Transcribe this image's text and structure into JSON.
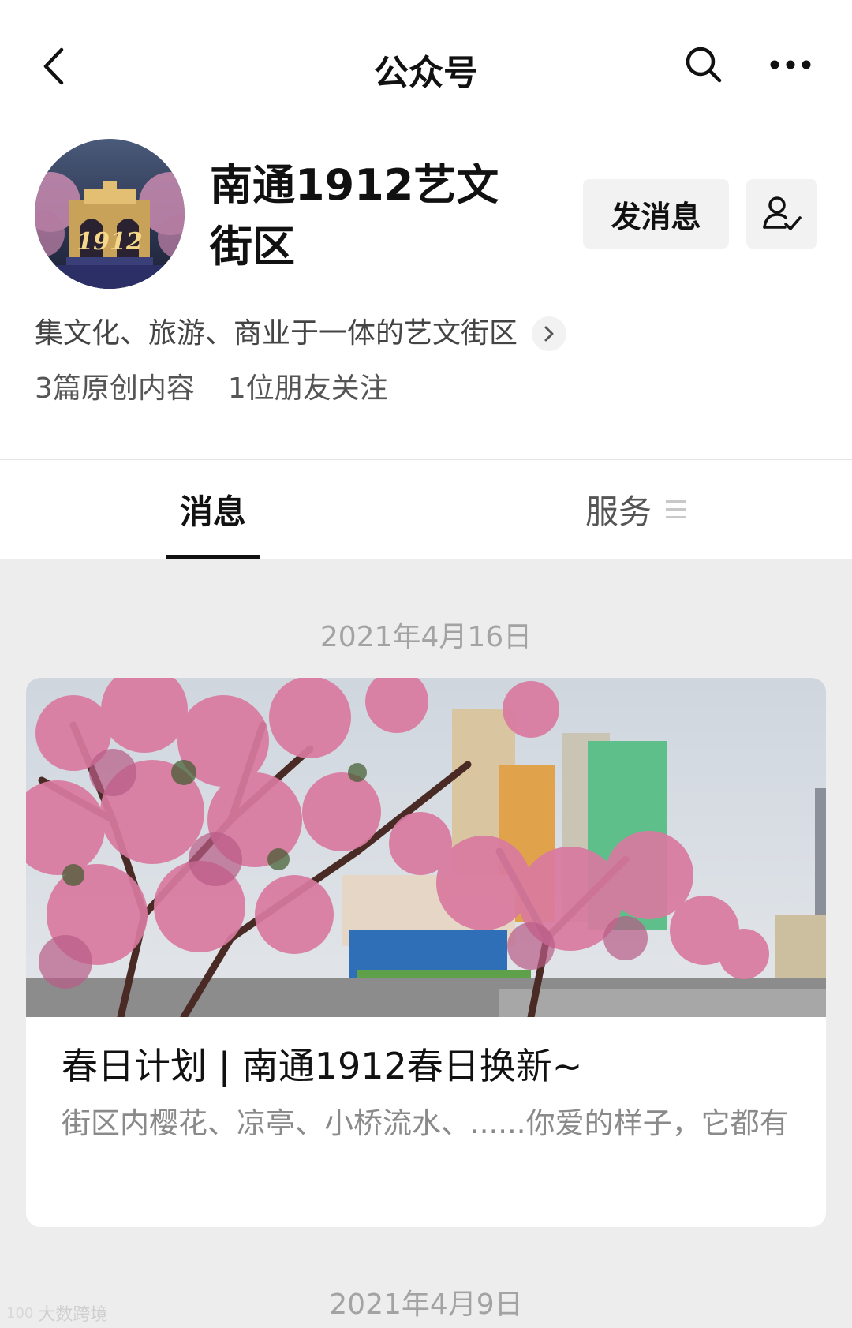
{
  "nav": {
    "title": "公众号",
    "back_icon": "chevron-left-icon",
    "search_icon": "search-icon",
    "more_icon": "more-dots-icon"
  },
  "profile": {
    "name": "南通1912艺文街区",
    "avatar_text": "1912",
    "message_button": "发消息",
    "follow_icon": "user-check-icon",
    "description": "集文化、旅游、商业于一体的艺文街区",
    "original_count": "3篇原创内容",
    "friends_following": "1位朋友关注"
  },
  "tabs": [
    {
      "label": "消息",
      "active": true
    },
    {
      "label": "服务",
      "active": false
    }
  ],
  "feed": [
    {
      "date": "2021年4月16日",
      "title": "春日计划 | 南通1912春日换新~",
      "summary": "街区内樱花、凉亭、小桥流水、......你爱的样子，它都有"
    },
    {
      "date": "2021年4月9日"
    }
  ],
  "watermark": {
    "logo": "100",
    "text": "大数跨境"
  },
  "colors": {
    "page_bg": "#ededed",
    "card_bg": "#ffffff",
    "button_bg": "#f2f2f2",
    "muted_text": "#a3a3a3",
    "blossom": "#d97aa0"
  }
}
